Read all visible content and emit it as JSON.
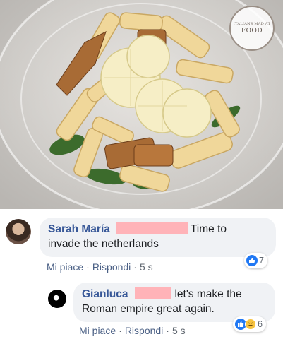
{
  "photo": {
    "logo_small": "ITALIANS MAD AT",
    "logo_big": "FOOD"
  },
  "comments": [
    {
      "author": "Sarah María",
      "text_after_redaction": "Time to",
      "text_line2": "invade the netherlands",
      "like_label": "Mi piace",
      "reply_label": "Rispondi",
      "time": "5 s",
      "reaction_count": "7",
      "reaction_icons": [
        "like-icon"
      ]
    },
    {
      "author": "Gianluca",
      "text_after_redaction": "let's make the",
      "text_line2": "Roman empire great again.",
      "like_label": "Mi piace",
      "reply_label": "Rispondi",
      "time": "5 s",
      "reaction_count": "6",
      "reaction_icons": [
        "like-icon",
        "haha-icon"
      ]
    }
  ],
  "separator": "·",
  "colors": {
    "author": "#385898",
    "actions": "#4b6085",
    "bubble": "#f0f2f5",
    "like": "#2078f4",
    "redaction": "#ffb3b8"
  }
}
